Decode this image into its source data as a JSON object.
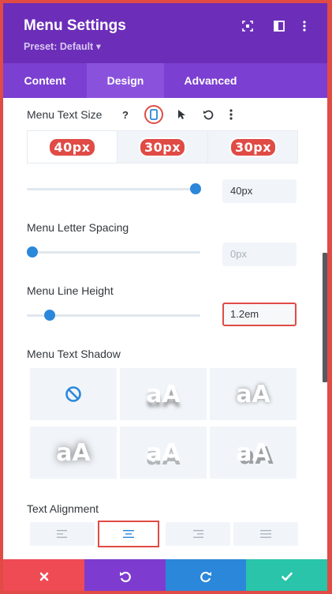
{
  "header": {
    "title": "Menu Settings",
    "preset": "Preset: Default ▾"
  },
  "tabs": [
    {
      "label": "Content"
    },
    {
      "label": "Design"
    },
    {
      "label": "Advanced"
    }
  ],
  "text_size": {
    "label": "Menu Text Size",
    "help_glyph": "?",
    "devices": [
      "40px",
      "30px",
      "30px"
    ],
    "value": "40px",
    "slider_fraction": 1.0
  },
  "letter_spacing": {
    "label": "Menu Letter Spacing",
    "placeholder": "0px",
    "slider_fraction": 0.0
  },
  "line_height": {
    "label": "Menu Line Height",
    "value": "1.2em",
    "slider_fraction": 0.13
  },
  "text_shadow": {
    "label": "Menu Text Shadow",
    "preview_text": "aA",
    "options": [
      "none",
      "shadow-1",
      "shadow-2",
      "shadow-3",
      "shadow-4",
      "shadow-5"
    ]
  },
  "text_alignment": {
    "label": "Text Alignment",
    "options": [
      "left",
      "center",
      "right",
      "justify"
    ],
    "selected": "center"
  },
  "footer": {
    "buttons": [
      "close",
      "undo",
      "redo",
      "save"
    ]
  },
  "colors": {
    "header": "#6c2eb9",
    "tabs": "#7b3fd1",
    "accent_blue": "#2b87da",
    "highlight_red": "#e04b45",
    "cancel": "#ef4b55",
    "undo": "#7e3bd0",
    "redo": "#2b87da",
    "save": "#29c4a9"
  }
}
